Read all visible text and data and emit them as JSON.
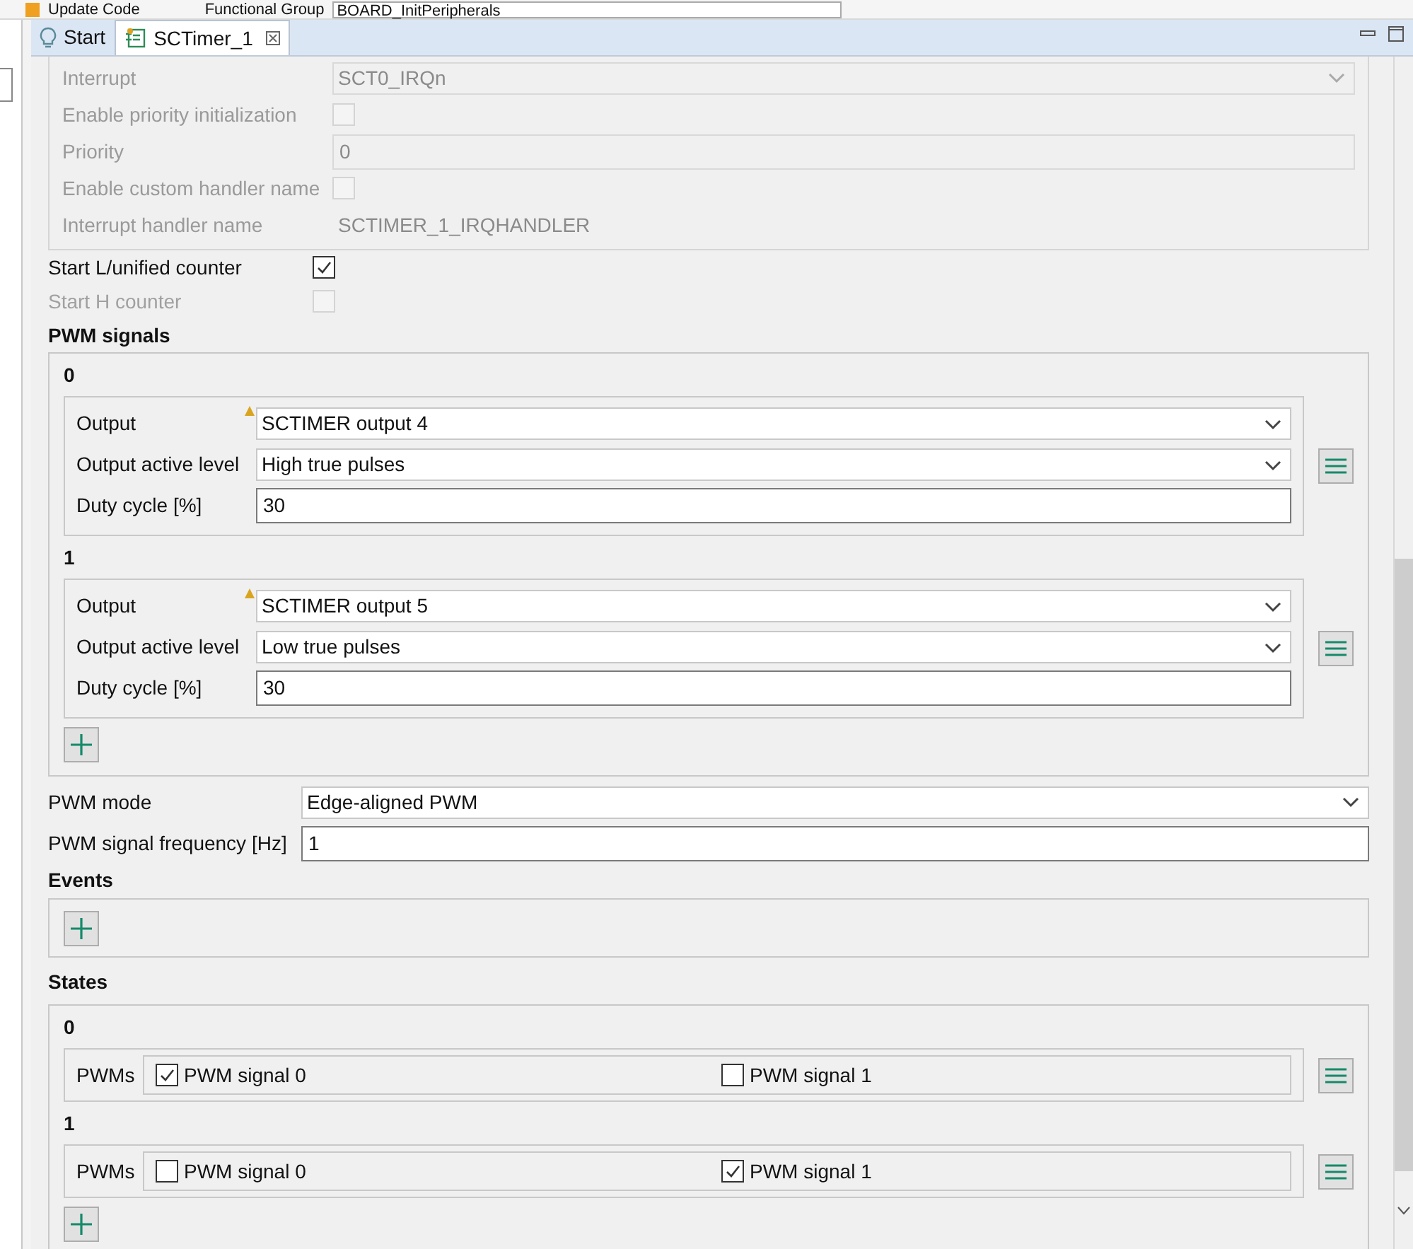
{
  "toolbar": {
    "update_button": "Update Code",
    "group_label": "Functional Group",
    "group_value": "BOARD_InitPeripherals"
  },
  "tabs": [
    {
      "label": "Start",
      "selected": false,
      "kind": "start"
    },
    {
      "label": "SCTimer_1",
      "selected": true,
      "kind": "component"
    }
  ],
  "interrupt_group": {
    "disabled": true,
    "rows": [
      {
        "kind": "select",
        "label": "Interrupt",
        "value": "SCT0_IRQn"
      },
      {
        "kind": "checkbox",
        "label": "Enable priority initialization",
        "checked": false
      },
      {
        "kind": "input",
        "label": "Priority",
        "value": "0"
      },
      {
        "kind": "checkbox",
        "label": "Enable custom handler name",
        "checked": false
      },
      {
        "kind": "text",
        "label": "Interrupt handler name",
        "value": "SCTIMER_1_IRQHANDLER"
      }
    ]
  },
  "counters": [
    {
      "label": "Start L/unified counter",
      "checked": true,
      "disabled": false
    },
    {
      "label": "Start H counter",
      "checked": false,
      "disabled": true
    }
  ],
  "pwm_signals": {
    "title": "PWM signals",
    "items": [
      {
        "index": "0",
        "fields": [
          {
            "kind": "select",
            "label": "Output",
            "value": "SCTIMER output 4",
            "warning": true
          },
          {
            "kind": "select",
            "label": "Output active level",
            "value": "High true pulses",
            "warning": false
          },
          {
            "kind": "input",
            "label": "Duty cycle [%]",
            "value": "30",
            "warning": false
          }
        ]
      },
      {
        "index": "1",
        "fields": [
          {
            "kind": "select",
            "label": "Output",
            "value": "SCTIMER output 5",
            "warning": true
          },
          {
            "kind": "select",
            "label": "Output active level",
            "value": "Low true pulses",
            "warning": false
          },
          {
            "kind": "input",
            "label": "Duty cycle [%]",
            "value": "30",
            "warning": false
          }
        ]
      }
    ]
  },
  "pwm_mode": {
    "label": "PWM mode",
    "value": "Edge-aligned PWM"
  },
  "pwm_frequency": {
    "label": "PWM signal frequency [Hz]",
    "value": "1"
  },
  "events": {
    "title": "Events"
  },
  "states": {
    "title": "States",
    "items": [
      {
        "index": "0",
        "label": "PWMs",
        "signals": [
          {
            "label": "PWM signal 0",
            "checked": true
          },
          {
            "label": "PWM signal 1",
            "checked": false
          }
        ]
      },
      {
        "index": "1",
        "label": "PWMs",
        "signals": [
          {
            "label": "PWM signal 0",
            "checked": false
          },
          {
            "label": "PWM signal 1",
            "checked": true
          }
        ]
      }
    ]
  }
}
